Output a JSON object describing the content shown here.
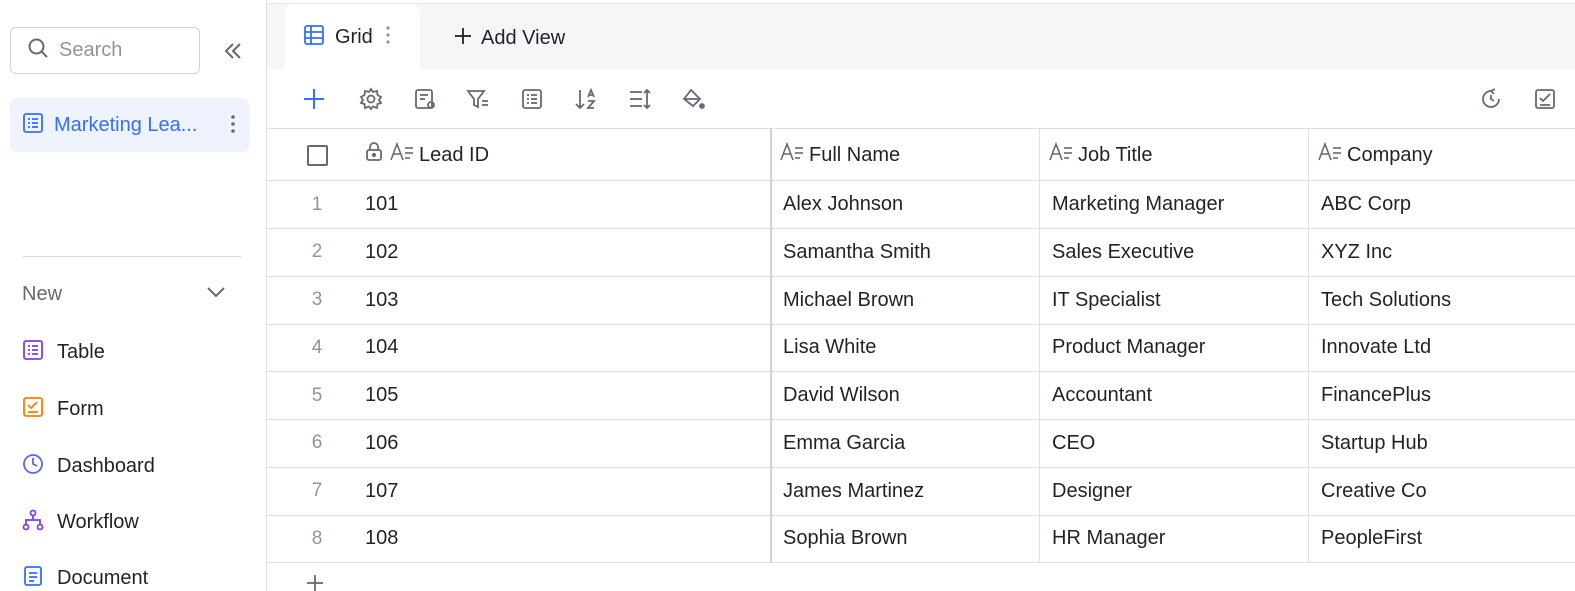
{
  "sidebar": {
    "search_placeholder": "Search",
    "active_item": {
      "label": "Marketing Lea..."
    },
    "new_section": {
      "label": "New"
    },
    "create_items": [
      {
        "label": "Table",
        "icon": "table-icon",
        "color": "#7f3bf5"
      },
      {
        "label": "Form",
        "icon": "form-icon",
        "color": "#ff7d00"
      },
      {
        "label": "Dashboard",
        "icon": "dashboard-icon",
        "color": "#5b65f5"
      },
      {
        "label": "Workflow",
        "icon": "workflow-icon",
        "color": "#7f3bf5"
      },
      {
        "label": "Document",
        "icon": "document-icon",
        "color": "#3370ff"
      }
    ]
  },
  "views": {
    "active_tab": {
      "label": "Grid"
    },
    "add_view_label": "Add View"
  },
  "grid": {
    "columns": [
      {
        "label": "Lead ID",
        "locked": true
      },
      {
        "label": "Full Name"
      },
      {
        "label": "Job Title"
      },
      {
        "label": "Company"
      }
    ],
    "rows": [
      {
        "index": "1",
        "lead_id": "101",
        "full_name": "Alex Johnson",
        "job_title": "Marketing Manager",
        "company": "ABC Corp"
      },
      {
        "index": "2",
        "lead_id": "102",
        "full_name": "Samantha Smith",
        "job_title": "Sales Executive",
        "company": "XYZ Inc"
      },
      {
        "index": "3",
        "lead_id": "103",
        "full_name": "Michael Brown",
        "job_title": "IT Specialist",
        "company": "Tech Solutions"
      },
      {
        "index": "4",
        "lead_id": "104",
        "full_name": "Lisa White",
        "job_title": "Product Manager",
        "company": "Innovate Ltd"
      },
      {
        "index": "5",
        "lead_id": "105",
        "full_name": "David Wilson",
        "job_title": "Accountant",
        "company": "FinancePlus"
      },
      {
        "index": "6",
        "lead_id": "106",
        "full_name": "Emma Garcia",
        "job_title": "CEO",
        "company": "Startup Hub"
      },
      {
        "index": "7",
        "lead_id": "107",
        "full_name": "James Martinez",
        "job_title": "Designer",
        "company": "Creative Co"
      },
      {
        "index": "8",
        "lead_id": "108",
        "full_name": "Sophia Brown",
        "job_title": "HR Manager",
        "company": "PeopleFirst"
      }
    ]
  },
  "colors": {
    "accent": "#3370ff",
    "accent_bg": "#eef3fe",
    "border": "#dee0e3",
    "muted": "#8f959e"
  }
}
